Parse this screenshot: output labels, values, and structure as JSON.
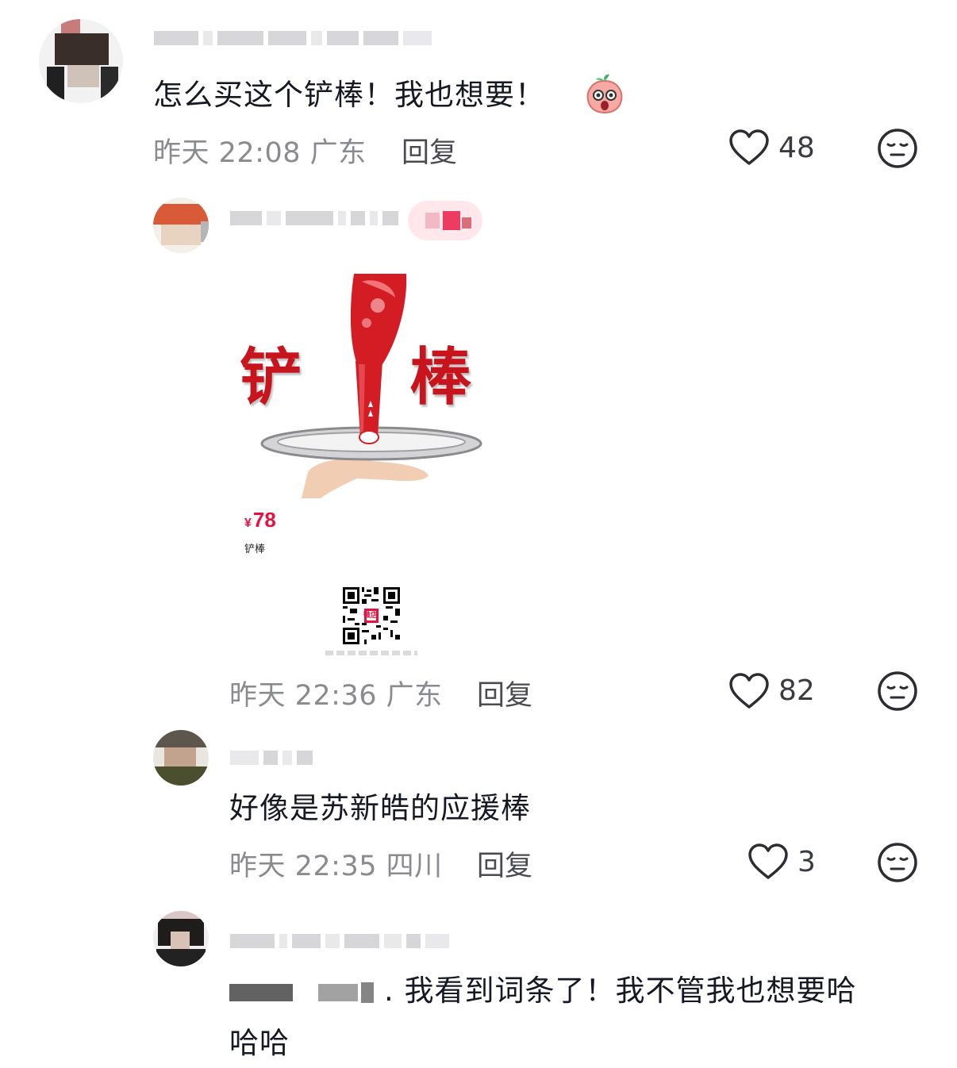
{
  "comments": [
    {
      "text": "怎么买这个铲棒！我也想要！",
      "emoji": "shocked-peach-emoji",
      "time": "昨天 22:08",
      "location": "广东",
      "reply_label": "回复",
      "likes": "48"
    },
    {
      "product": {
        "title_left": "铲",
        "title_right": "棒",
        "price_symbol": "¥",
        "price": "78",
        "name": "铲棒",
        "qr_label": "微店"
      },
      "time": "昨天 22:36",
      "location": "广东",
      "reply_label": "回复",
      "likes": "82"
    },
    {
      "text": "好像是苏新皓的应援棒",
      "time": "昨天 22:35",
      "location": "四川",
      "reply_label": "回复",
      "likes": "3"
    },
    {
      "text_line1": ". 我看到词条了！我不管我也想要哈",
      "text_line2": "哈哈"
    }
  ],
  "colors": {
    "accent": "#e8103e",
    "product_red": "#c8141c",
    "meta_gray": "#8a8b91"
  },
  "icons": {
    "like": "heart-outline-icon",
    "dislike": "neutral-face-icon"
  }
}
